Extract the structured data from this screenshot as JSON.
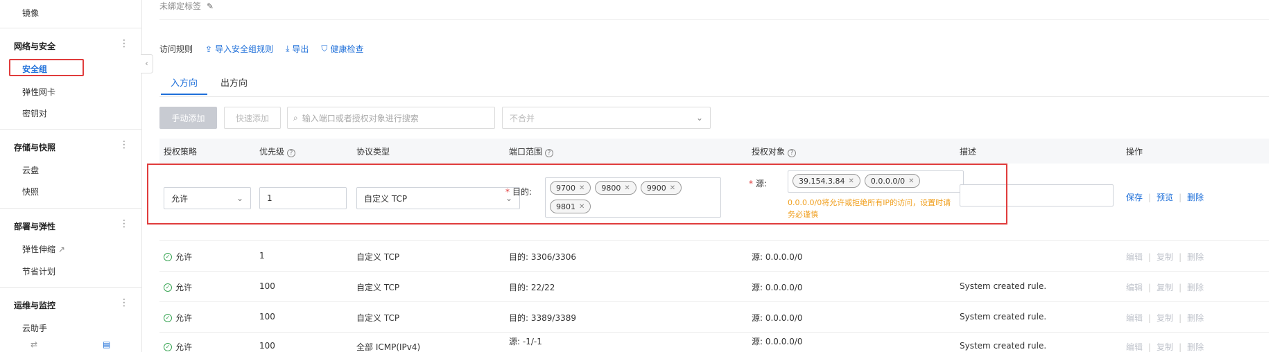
{
  "sidebar": {
    "image_label": "镜像",
    "group_network": "网络与安全",
    "item_security_group": "安全组",
    "item_eni": "弹性网卡",
    "item_keypair": "密钥对",
    "group_storage": "存储与快照",
    "item_disk": "云盘",
    "item_snapshot": "快照",
    "group_deploy": "部署与弹性",
    "item_autoscaling": "弹性伸缩",
    "item_savings": "节省计划",
    "group_ops": "运维与监控",
    "item_cloud_assistant": "云助手"
  },
  "header": {
    "tag_text": "未绑定标签",
    "rules_title": "访问规则",
    "import_link": "导入安全组规则",
    "export_link": "导出",
    "health_link": "健康检查"
  },
  "tabs": {
    "inbound": "入方向",
    "outbound": "出方向"
  },
  "toolbar": {
    "manual_add": "手动添加",
    "quick_add": "快速添加",
    "search_placeholder": "输入端口或者授权对象进行搜索",
    "merge_value": "不合并"
  },
  "table": {
    "headers": {
      "policy": "授权策略",
      "priority": "优先级",
      "protocol": "协议类型",
      "port_range": "端口范围",
      "auth_object": "授权对象",
      "description": "描述",
      "actions": "操作"
    },
    "edit_row": {
      "policy": "允许",
      "priority": "1",
      "protocol": "自定义 TCP",
      "dest_label": "目的:",
      "ports": [
        "9700",
        "9800",
        "9900",
        "9801"
      ],
      "src_label": "源:",
      "sources": [
        "39.154.3.84",
        "0.0.0.0/0"
      ],
      "warning": "0.0.0.0/0将允许或拒绝所有IP的访问，设置时请务必谨慎",
      "description": "",
      "save": "保存",
      "preview": "预览",
      "delete": "删除"
    },
    "rows": [
      {
        "policy": "允许",
        "priority": "1",
        "protocol": "自定义 TCP",
        "port": "目的: 3306/3306",
        "source": "源: 0.0.0.0/0",
        "desc": ""
      },
      {
        "policy": "允许",
        "priority": "100",
        "protocol": "自定义 TCP",
        "port": "目的: 22/22",
        "source": "源: 0.0.0.0/0",
        "desc": "System created rule."
      },
      {
        "policy": "允许",
        "priority": "100",
        "protocol": "自定义 TCP",
        "port": "目的: 3389/3389",
        "source": "源: 0.0.0.0/0",
        "desc": "System created rule."
      },
      {
        "policy": "允许",
        "priority": "100",
        "protocol": "全部 ICMP(IPv4)",
        "port": "源: -1/-1",
        "source": "源: 0.0.0.0/0",
        "desc": "System created rule."
      }
    ],
    "row_actions": {
      "edit": "编辑",
      "copy": "复制",
      "delete": "删除"
    }
  }
}
